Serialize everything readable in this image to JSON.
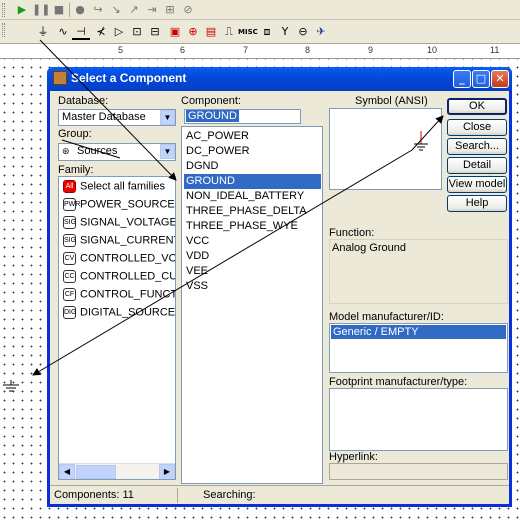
{
  "ruler": {
    "marks": [
      "5",
      "6",
      "7",
      "8",
      "9",
      "10",
      "11"
    ]
  },
  "dialog": {
    "title": "Select a Component",
    "database_label": "Database:",
    "database_value": "Master Database",
    "group_label": "Group:",
    "group_value": "Sources",
    "family_label": "Family:",
    "families": [
      {
        "icon": "All",
        "label": "Select all families"
      },
      {
        "icon": "PWR",
        "label": "POWER_SOURCES"
      },
      {
        "icon": "SIG",
        "label": "SIGNAL_VOLTAGE_SOU"
      },
      {
        "icon": "SIG",
        "label": "SIGNAL_CURRENT_SO"
      },
      {
        "icon": "CV",
        "label": "CONTROLLED_VOLTAG"
      },
      {
        "icon": "CC",
        "label": "CONTROLLED_CURREN"
      },
      {
        "icon": "CF",
        "label": "CONTROL_FUNCTION_"
      },
      {
        "icon": "DIG",
        "label": "DIGITAL_SOURCES"
      }
    ],
    "component_label": "Component:",
    "component_search": "GROUND",
    "components": [
      "AC_POWER",
      "DC_POWER",
      "DGND",
      "GROUND",
      "NON_IDEAL_BATTERY",
      "THREE_PHASE_DELTA",
      "THREE_PHASE_WYE",
      "VCC",
      "VDD",
      "VEE",
      "VSS"
    ],
    "selected_component": "GROUND",
    "symbol_label": "Symbol (ANSI)",
    "function_label": "Function:",
    "function_value": "Analog Ground",
    "model_label": "Model manufacturer/ID:",
    "model_value": "Generic / EMPTY",
    "footprint_label": "Footprint manufacturer/type:",
    "hyperlink_label": "Hyperlink:",
    "buttons": {
      "ok": "OK",
      "close": "Close",
      "search": "Search...",
      "detail": "Detail report",
      "view_model": "View model",
      "help": "Help"
    },
    "status_components": "Components: 11",
    "status_searching": "Searching:"
  },
  "colors": {
    "titlebar": "#0449d8",
    "selection": "#316ac5",
    "dialog_bg": "#ece9d8"
  }
}
